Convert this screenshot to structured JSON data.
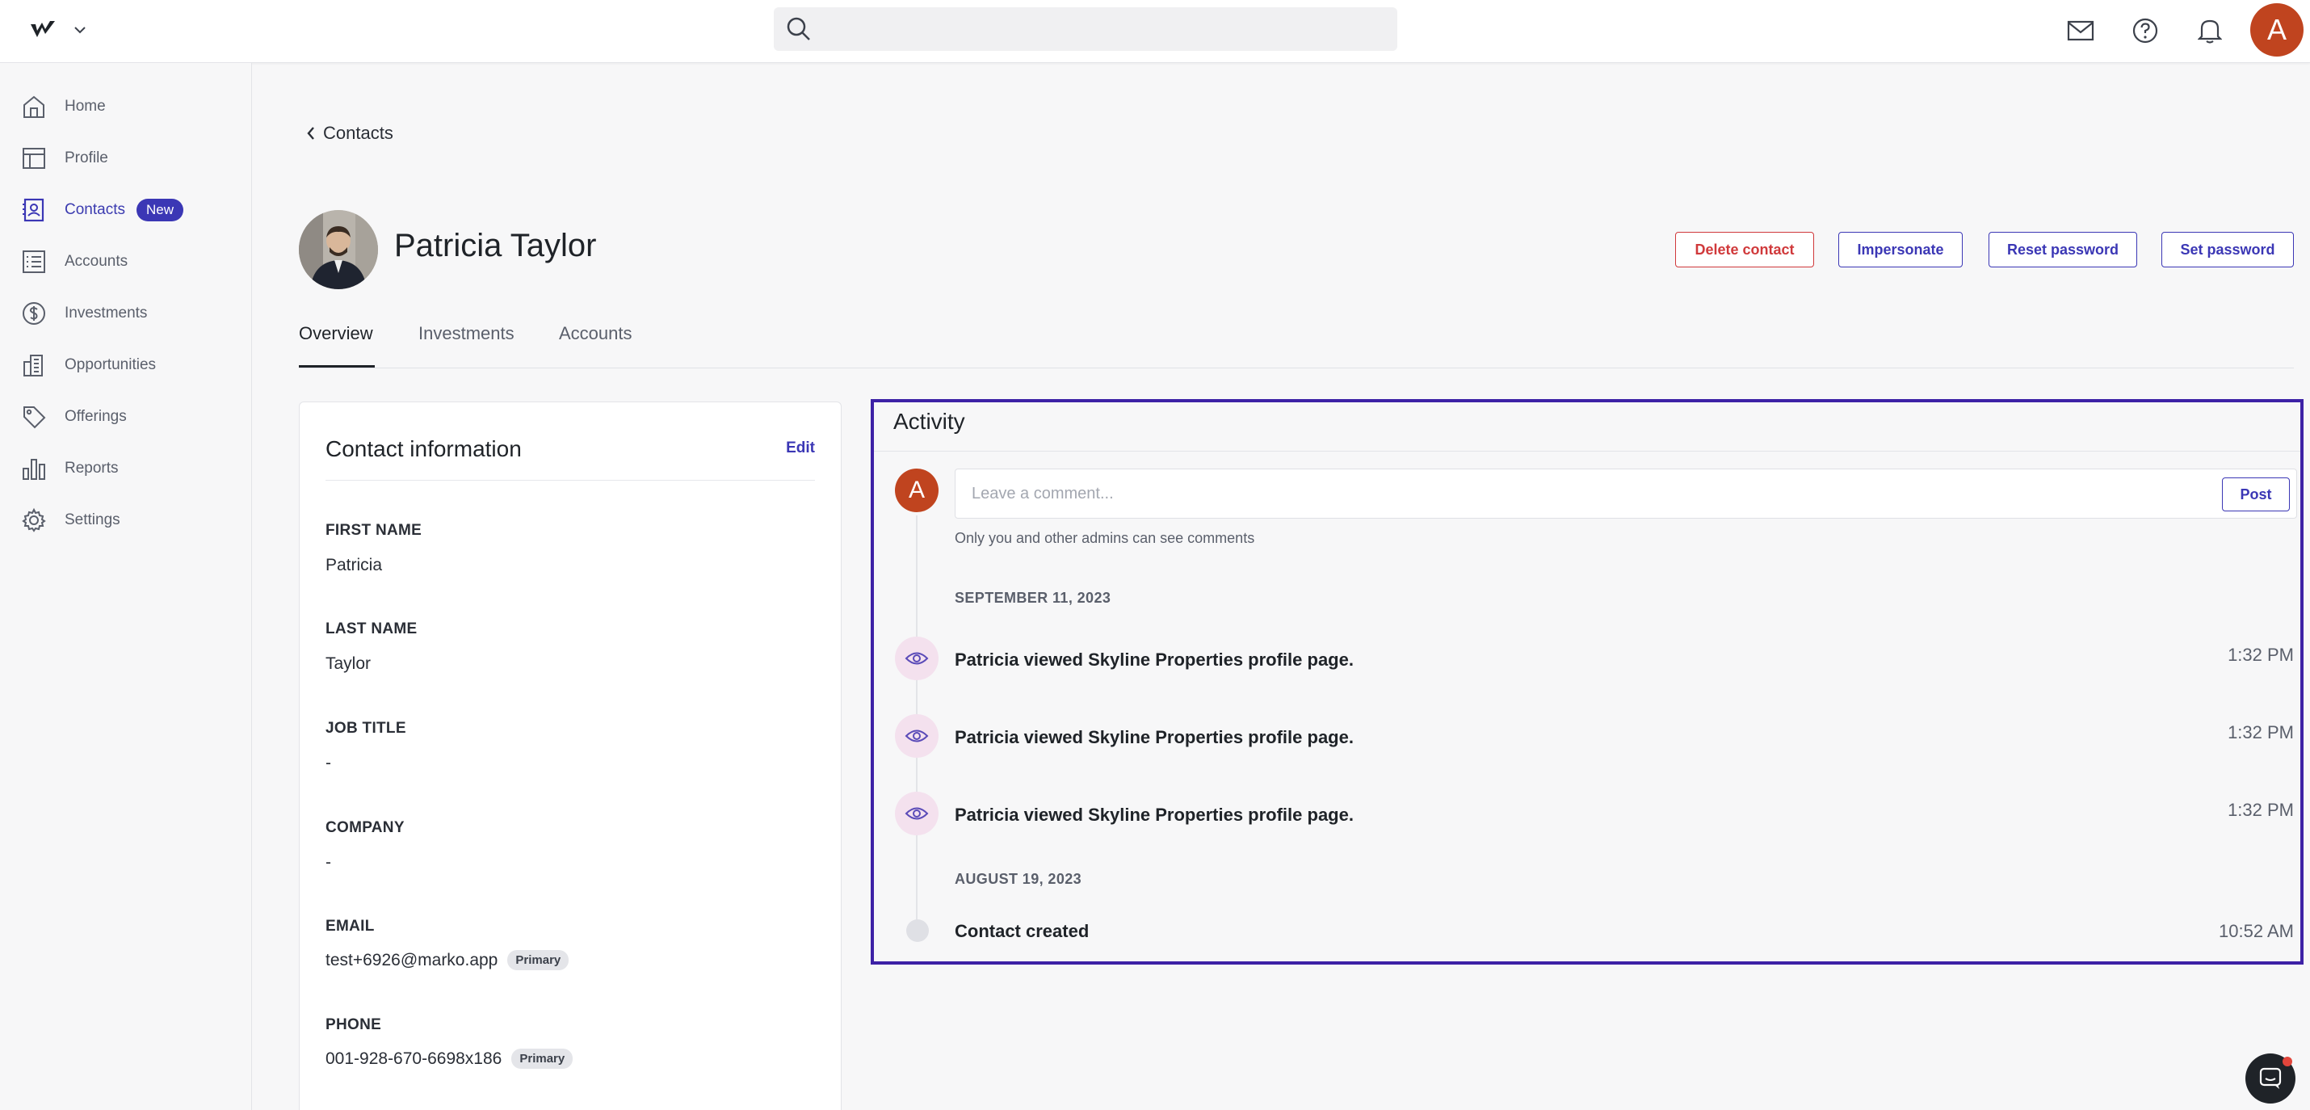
{
  "header": {
    "search_placeholder": "",
    "user_initial": "A"
  },
  "sidebar": {
    "items": [
      {
        "label": "Home",
        "icon": "home-icon"
      },
      {
        "label": "Profile",
        "icon": "profile-icon"
      },
      {
        "label": "Contacts",
        "icon": "contacts-icon",
        "badge": "New",
        "active": true
      },
      {
        "label": "Accounts",
        "icon": "accounts-icon"
      },
      {
        "label": "Investments",
        "icon": "dollar-icon"
      },
      {
        "label": "Opportunities",
        "icon": "building-icon"
      },
      {
        "label": "Offerings",
        "icon": "tag-icon"
      },
      {
        "label": "Reports",
        "icon": "bar-chart-icon"
      },
      {
        "label": "Settings",
        "icon": "gear-icon"
      }
    ]
  },
  "breadcrumb": {
    "back_label": "Contacts"
  },
  "contact": {
    "name": "Patricia Taylor"
  },
  "actions": {
    "delete": "Delete contact",
    "impersonate": "Impersonate",
    "reset_password": "Reset password",
    "set_password": "Set password"
  },
  "tabs": [
    {
      "label": "Overview",
      "active": true
    },
    {
      "label": "Investments"
    },
    {
      "label": "Accounts"
    }
  ],
  "contact_info": {
    "title": "Contact information",
    "edit_label": "Edit",
    "fields": [
      {
        "label": "FIRST NAME",
        "value": "Patricia"
      },
      {
        "label": "LAST NAME",
        "value": "Taylor"
      },
      {
        "label": "JOB TITLE",
        "value": "-"
      },
      {
        "label": "COMPANY",
        "value": "-"
      },
      {
        "label": "EMAIL",
        "value": "test+6926@marko.app",
        "badge": "Primary"
      },
      {
        "label": "PHONE",
        "value": "001-928-670-6698x186",
        "badge": "Primary"
      }
    ]
  },
  "activity": {
    "title": "Activity",
    "avatar_initial": "A",
    "comment_placeholder": "Leave a comment...",
    "post_label": "Post",
    "note": "Only you and other admins can see comments",
    "groups": [
      {
        "date": "SEPTEMBER 11, 2023",
        "events": [
          {
            "text": "Patricia viewed Skyline Properties profile page.",
            "time": "1:32 PM",
            "icon": "eye-icon"
          },
          {
            "text": "Patricia viewed Skyline Properties profile page.",
            "time": "1:32 PM",
            "icon": "eye-icon"
          },
          {
            "text": "Patricia viewed Skyline Properties profile page.",
            "time": "1:32 PM",
            "icon": "eye-icon"
          }
        ]
      },
      {
        "date": "AUGUST 19, 2023",
        "events": [
          {
            "text": "Contact created",
            "time": "10:52 AM",
            "icon": "dot-icon"
          }
        ]
      }
    ]
  },
  "colors": {
    "accent": "#3b37b5",
    "danger": "#d0393b",
    "avatar": "#c0441f",
    "highlight_border": "#3d21a6"
  }
}
